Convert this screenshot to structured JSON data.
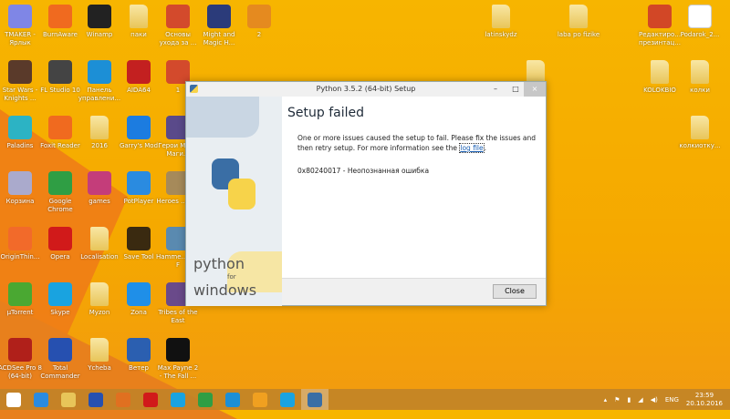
{
  "desktop_icons": [
    {
      "label": "TMAKER - Ярлык",
      "color": "#7f86e6",
      "col": 0,
      "row": 0
    },
    {
      "label": "BurnAware",
      "color": "#f06a1f",
      "col": 1,
      "row": 0
    },
    {
      "label": "Winamp",
      "color": "#222",
      "col": 2,
      "row": 0
    },
    {
      "label": "паки",
      "type": "folder",
      "col": 3,
      "row": 0
    },
    {
      "label": "Основы ухода за ...",
      "color": "#d34a2c",
      "col": 4,
      "row": 0
    },
    {
      "label": "Might and Magic H...",
      "color": "#2b3b7a",
      "col": 5,
      "row": 0
    },
    {
      "label": "2",
      "color": "#e58a1f",
      "col": 6,
      "row": 0
    },
    {
      "label": "Star Wars - Knights ...",
      "color": "#5a3a2a",
      "col": 0,
      "row": 1
    },
    {
      "label": "FL Studio 10",
      "color": "#444",
      "col": 1,
      "row": 1
    },
    {
      "label": "Панель управлени...",
      "color": "#1c8fd6",
      "col": 2,
      "row": 1
    },
    {
      "label": "AIDA64",
      "color": "#c32020",
      "col": 3,
      "row": 1
    },
    {
      "label": "1",
      "color": "#d34a2c",
      "col": 4,
      "row": 1
    },
    {
      "label": "Paladins",
      "color": "#2cb3c4",
      "col": 0,
      "row": 2
    },
    {
      "label": "Foxit Reader",
      "color": "#f06a1f",
      "col": 1,
      "row": 2
    },
    {
      "label": "2016",
      "type": "folder",
      "col": 2,
      "row": 2
    },
    {
      "label": "Garry's Mod",
      "color": "#1c7ce0",
      "col": 3,
      "row": 2
    },
    {
      "label": "Герои М... и Маги...",
      "color": "#5a4a8a",
      "col": 4,
      "row": 2
    },
    {
      "label": "Корзина",
      "color": "#aac",
      "col": 0,
      "row": 3
    },
    {
      "label": "Google Chrome",
      "color": "#2f9e44",
      "col": 1,
      "row": 3
    },
    {
      "label": "games",
      "color": "#c43d7a",
      "col": 2,
      "row": 3
    },
    {
      "label": "PotPlayer",
      "color": "#2a8be0",
      "col": 3,
      "row": 3
    },
    {
      "label": "Heroes ... Gol",
      "color": "#a68a5a",
      "col": 4,
      "row": 3
    },
    {
      "label": "OriginThin...",
      "color": "#f26a2a",
      "col": 0,
      "row": 4
    },
    {
      "label": "Opera",
      "color": "#d11a1a",
      "col": 1,
      "row": 4
    },
    {
      "label": "Localisation",
      "type": "folder",
      "col": 2,
      "row": 4
    },
    {
      "label": "Save Tool",
      "color": "#3a2a10",
      "col": 3,
      "row": 4
    },
    {
      "label": "Hamme... the F",
      "color": "#5a8ab0",
      "col": 4,
      "row": 4
    },
    {
      "label": "µTorrent",
      "color": "#4aa832",
      "col": 0,
      "row": 5
    },
    {
      "label": "Skype",
      "color": "#19a3e0",
      "col": 1,
      "row": 5
    },
    {
      "label": "Myzon",
      "type": "folder",
      "col": 2,
      "row": 5
    },
    {
      "label": "Zona",
      "color": "#1f8fe8",
      "col": 3,
      "row": 5
    },
    {
      "label": "Tribes of the East",
      "color": "#6a4a8a",
      "col": 4,
      "row": 5
    },
    {
      "label": "ACDSee Pro 8 (64-bit)",
      "color": "#b0201a",
      "col": 0,
      "row": 6
    },
    {
      "label": "Total Commander",
      "color": "#2650b0",
      "col": 1,
      "row": 6
    },
    {
      "label": "Ycheba",
      "type": "folder",
      "col": 2,
      "row": 6
    },
    {
      "label": "Ветер",
      "color": "#2b5fb0",
      "col": 3,
      "row": 6
    },
    {
      "label": "Max Payne 2 - The Fall ...",
      "color": "#111",
      "col": 4,
      "row": 6
    }
  ],
  "right_icons": [
    {
      "label": "latinskydz",
      "type": "folder"
    },
    {
      "label": "laba po fizike",
      "type": "folder"
    },
    {
      "label": "Редактиро... презинтац...",
      "color": "#d24726"
    },
    {
      "label": "Podarok_2...",
      "type": "doc"
    },
    {
      "label": "",
      "type": "folder"
    },
    {
      "label": "KOLOKBIO",
      "type": "folder"
    },
    {
      "label": "колки",
      "type": "folder"
    },
    {
      "label": "колкиотку...",
      "type": "folder"
    }
  ],
  "dialog": {
    "title": "Python 3.5.2 (64-bit) Setup",
    "heading": "Setup failed",
    "message_before": "One or more issues caused the setup to fail. Please fix the issues and then retry setup. For more information see the ",
    "link": "log file",
    "message_after": ".",
    "error": "0x80240017 - Неопознанная ошибка",
    "close_button": "Close",
    "logo_text_1": "python",
    "logo_text_2": "for",
    "logo_text_3": "windows",
    "minimize": "–",
    "maximize": "□",
    "close": "×"
  },
  "taskbar": {
    "items": [
      {
        "name": "start",
        "color": "#fff"
      },
      {
        "name": "ie",
        "color": "#2a8be0"
      },
      {
        "name": "explorer",
        "color": "#e8c559"
      },
      {
        "name": "total-commander",
        "color": "#2650b0"
      },
      {
        "name": "pencil",
        "color": "#e07020"
      },
      {
        "name": "opera",
        "color": "#d11a1a"
      },
      {
        "name": "skype",
        "color": "#19a3e0"
      },
      {
        "name": "chrome",
        "color": "#2f9e44"
      },
      {
        "name": "control-panel",
        "color": "#1c8fd6"
      },
      {
        "name": "search-app",
        "color": "#f0a020"
      },
      {
        "name": "skype-2",
        "color": "#19a3e0"
      },
      {
        "name": "python-setup",
        "color": "#3a6ea5"
      }
    ],
    "language": "ENG",
    "time": "23:59",
    "date": "20.10.2016"
  }
}
